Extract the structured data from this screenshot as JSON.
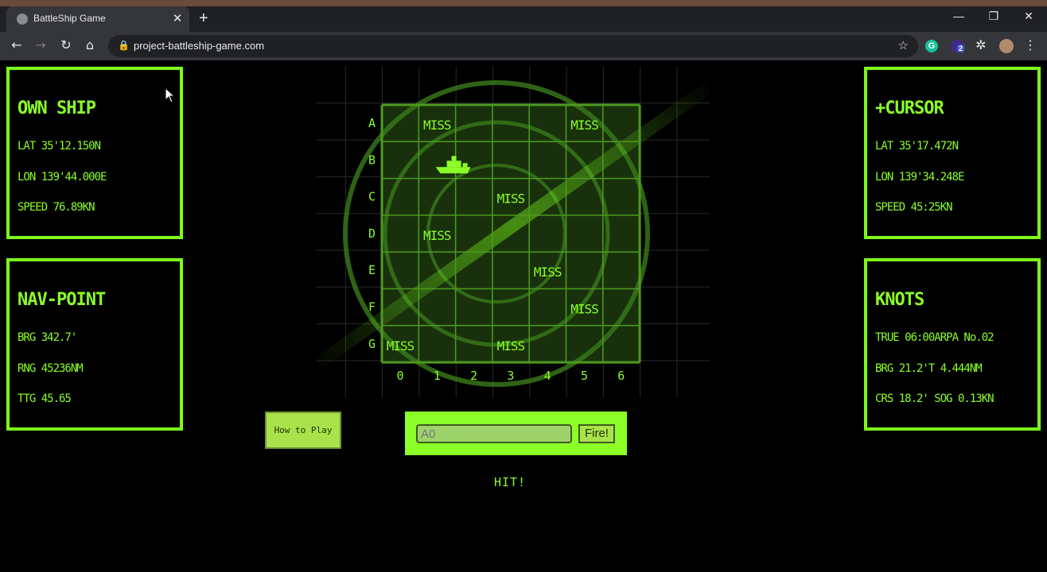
{
  "browser": {
    "tab_title": "BattleShip Game",
    "tab_close": "✕",
    "new_tab": "+",
    "minimize": "—",
    "restore": "❐",
    "close": "✕",
    "back": "←",
    "forward": "→",
    "reload": "↻",
    "home": "⌂",
    "lock": "🔒",
    "url": "project-battleship-game.com",
    "star": "☆",
    "ext_grammarly": "G",
    "ext_badge": "2",
    "extensions": "✲",
    "menu": "⋮"
  },
  "panels": {
    "own_ship": {
      "title": "OWN SHIP",
      "lines": [
        "LAT 35'12.150N",
        "LON 139'44.000E",
        "SPEED 76.89KN"
      ]
    },
    "nav_point": {
      "title": "NAV-POINT",
      "lines": [
        "BRG 342.7'",
        "RNG 45236NM",
        "TTG 45.65"
      ]
    },
    "cursor": {
      "title": "+CURSOR",
      "lines": [
        "LAT 35'17.472N",
        "LON 139'34.248E",
        "SPEED 45:25KN"
      ]
    },
    "knots": {
      "title": "KNOTS",
      "lines": [
        "TRUE 06:00ARPA No.02",
        "BRG 21.2'T 4.444NM",
        "CRS 18.2' SOG 0.13KN"
      ]
    }
  },
  "board": {
    "rows": [
      "A",
      "B",
      "C",
      "D",
      "E",
      "F",
      "G"
    ],
    "cols": [
      "0",
      "1",
      "2",
      "3",
      "4",
      "5",
      "6"
    ],
    "miss_label": "MISS",
    "misses": [
      {
        "row": 0,
        "col": 1
      },
      {
        "row": 0,
        "col": 5
      },
      {
        "row": 2,
        "col": 3
      },
      {
        "row": 3,
        "col": 1
      },
      {
        "row": 4,
        "col": 4
      },
      {
        "row": 5,
        "col": 5
      },
      {
        "row": 6,
        "col": 0
      },
      {
        "row": 6,
        "col": 3
      }
    ],
    "hits": [
      {
        "row": 1,
        "col": 2
      }
    ]
  },
  "controls": {
    "how_to_play": "How to Play",
    "coord_placeholder": "A0",
    "fire_label": "Fire!",
    "result": "HIT!"
  },
  "colors": {
    "accent": "#7cfc1b",
    "board_line": "#4e9a1f"
  }
}
